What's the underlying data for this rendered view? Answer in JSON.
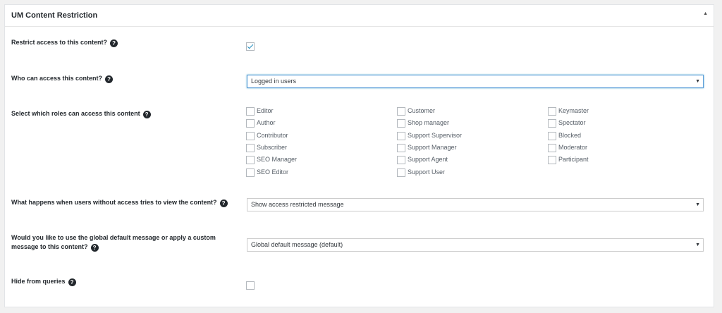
{
  "metabox": {
    "title": "UM Content Restriction",
    "toggle_glyph": "▲"
  },
  "fields": {
    "restrict": {
      "label": "Restrict access to this content?",
      "checked": true
    },
    "who": {
      "label": "Who can access this content?",
      "value": "Logged in users"
    },
    "roles": {
      "label": "Select which roles can access this content",
      "columns": [
        [
          "Editor",
          "Author",
          "Contributor",
          "Subscriber",
          "SEO Manager",
          "SEO Editor"
        ],
        [
          "Customer",
          "Shop manager",
          "Support Supervisor",
          "Support Manager",
          "Support Agent",
          "Support User"
        ],
        [
          "Keymaster",
          "Spectator",
          "Blocked",
          "Moderator",
          "Participant"
        ]
      ]
    },
    "no_access": {
      "label": "What happens when users without access tries to view the content?",
      "value": "Show access restricted message"
    },
    "message": {
      "label_line1": "Would you like to use the global default message or apply a custom",
      "label_line2": "message to this content?",
      "value": "Global default message (default)"
    },
    "hide": {
      "label": "Hide from queries",
      "checked": false
    }
  },
  "help_glyph": "?",
  "dropdown_glyph": "▼"
}
